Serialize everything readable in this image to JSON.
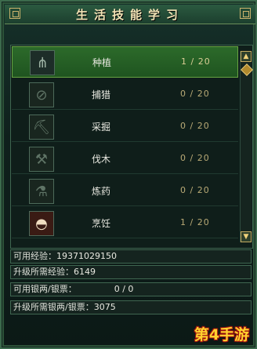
{
  "window": {
    "title": "生活技能学习"
  },
  "skills": [
    {
      "name": "种植",
      "progress": "1 / 20",
      "icon": "rake-icon",
      "glyph": "⋔",
      "locked": false,
      "selected": true
    },
    {
      "name": "捕猎",
      "progress": "0 / 20",
      "icon": "trap-icon",
      "glyph": "⊘",
      "locked": true,
      "selected": false
    },
    {
      "name": "采掘",
      "progress": "0 / 20",
      "icon": "shovel-icon",
      "glyph": "⛏",
      "locked": true,
      "selected": false
    },
    {
      "name": "伐木",
      "progress": "0 / 20",
      "icon": "axe-icon",
      "glyph": "⚒",
      "locked": true,
      "selected": false
    },
    {
      "name": "炼药",
      "progress": "0 / 20",
      "icon": "potion-icon",
      "glyph": "⚗",
      "locked": true,
      "selected": false
    },
    {
      "name": "烹饪",
      "progress": "1 / 20",
      "icon": "dumpling-dish-icon",
      "glyph": "◓",
      "locked": false,
      "selected": false
    }
  ],
  "info": {
    "exp_label": "可用经验：",
    "exp_value": "19371029150",
    "need_exp_label": "升级所需经验：",
    "need_exp_value": "6149",
    "silver_label": "可用银两/银票：",
    "silver_value": "0 / 0",
    "need_silver_label": "升级所需银两/银票：",
    "need_silver_value": "3075"
  },
  "watermark": "第4手游"
}
